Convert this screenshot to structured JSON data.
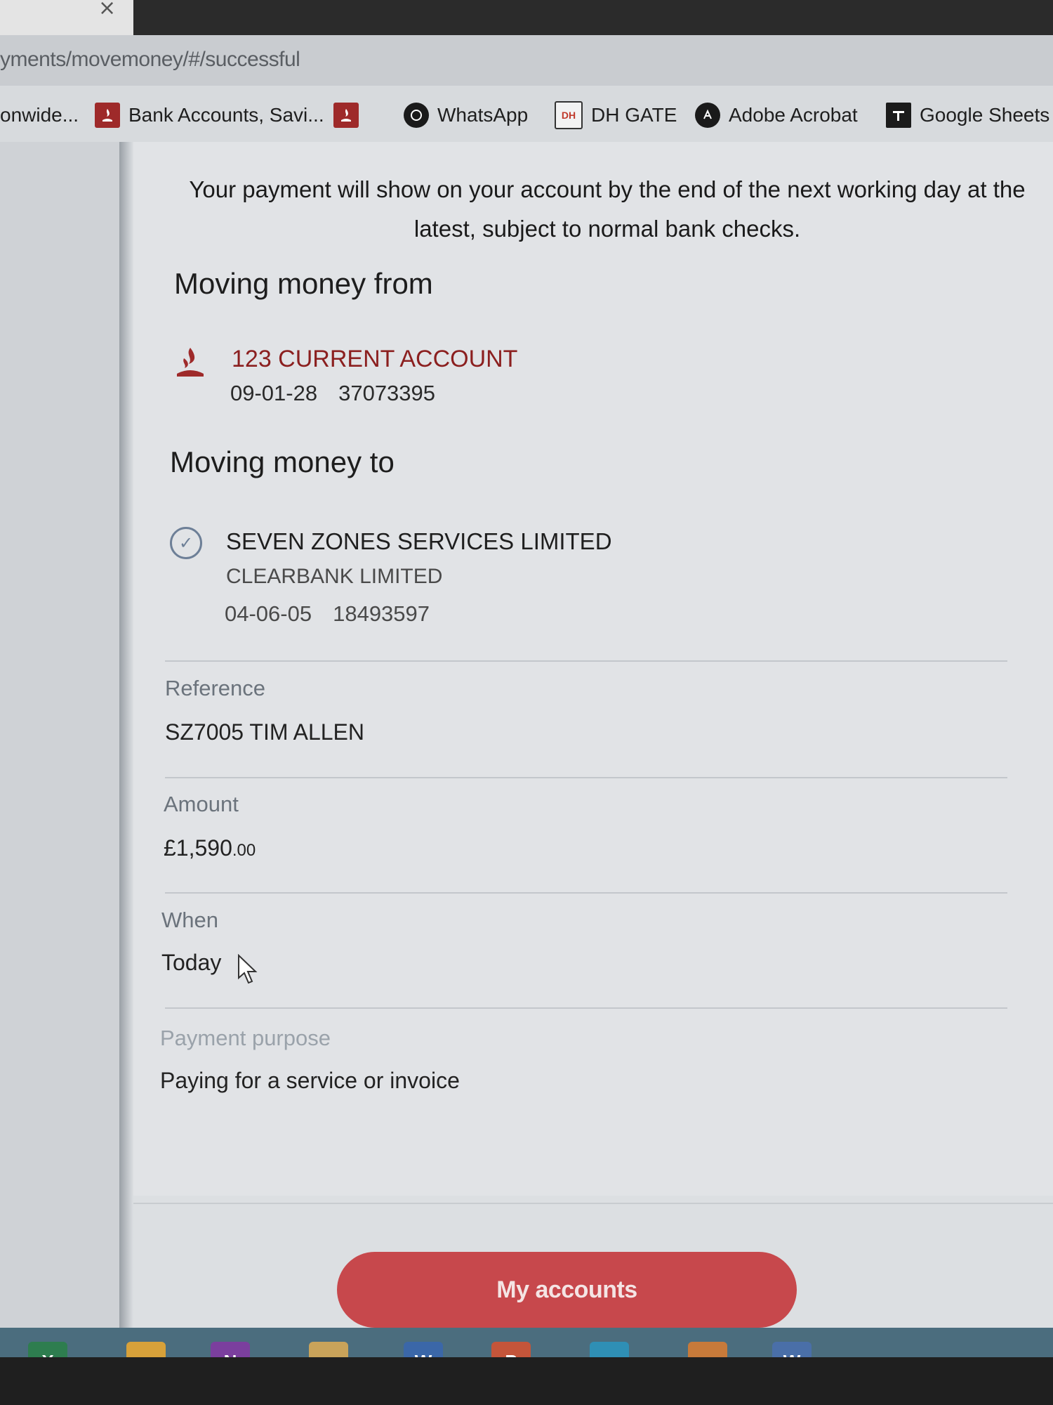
{
  "browser": {
    "tab_close": "×",
    "address": "yments/movemoney/#/successful",
    "bookmarks": [
      {
        "label": "onwide...",
        "icon": "none"
      },
      {
        "label": "Bank Accounts, Savi...",
        "icon": "santander-flame-icon"
      },
      {
        "label": "",
        "icon": "santander-flame-icon"
      },
      {
        "label": "WhatsApp",
        "icon": "whatsapp-icon"
      },
      {
        "label": "DH GATE",
        "icon": "dhgate-icon"
      },
      {
        "label": "Adobe Acrobat",
        "icon": "adobe-acrobat-icon"
      },
      {
        "label": "Google Sheets",
        "icon": "google-sheets-icon"
      }
    ],
    "dh_icon_text": "DH"
  },
  "page": {
    "notice": "Your payment will show on your account by the end of the next working day at the latest, subject to normal bank checks.",
    "from": {
      "heading": "Moving money from",
      "account_name": "123 CURRENT ACCOUNT",
      "sort_code": "09-01-28",
      "account_number": "37073395"
    },
    "to": {
      "heading": "Moving money to",
      "payee_name": "SEVEN ZONES SERVICES LIMITED",
      "bank_name": "CLEARBANK LIMITED",
      "sort_code": "04-06-05",
      "account_number": "18493597",
      "check_glyph": "✓"
    },
    "fields": {
      "reference_label": "Reference",
      "reference_value": "SZ7005 TIM ALLEN",
      "amount_label": "Amount",
      "amount_main": "£1,590",
      "amount_pence": ".00",
      "when_label": "When",
      "when_value": "Today",
      "purpose_label": "Payment purpose",
      "purpose_value": "Paying for a service or invoice"
    },
    "primary_button": "My accounts"
  },
  "taskbar": {
    "apps": [
      {
        "name": "excel-icon",
        "glyph": "X",
        "color": "#2e7d4f"
      },
      {
        "name": "chrome-icon",
        "glyph": "",
        "color": "#d7a13a"
      },
      {
        "name": "onenote-icon",
        "glyph": "N",
        "color": "#7b3f9e"
      },
      {
        "name": "file-explorer-icon",
        "glyph": "",
        "color": "#c9a35a"
      },
      {
        "name": "word-doc-icon",
        "glyph": "W",
        "color": "#3b67a8"
      },
      {
        "name": "powerpoint-icon",
        "glyph": "P",
        "color": "#c4553a"
      },
      {
        "name": "edge-icon",
        "glyph": "",
        "color": "#2f8fb5"
      },
      {
        "name": "firefox-icon",
        "glyph": "",
        "color": "#c77a3a"
      },
      {
        "name": "word-icon",
        "glyph": "W",
        "color": "#4a6fa8"
      }
    ]
  },
  "colors": {
    "brand_red": "#c7484c",
    "account_red": "#8b1f1f",
    "check_blue": "#6d7f97"
  }
}
